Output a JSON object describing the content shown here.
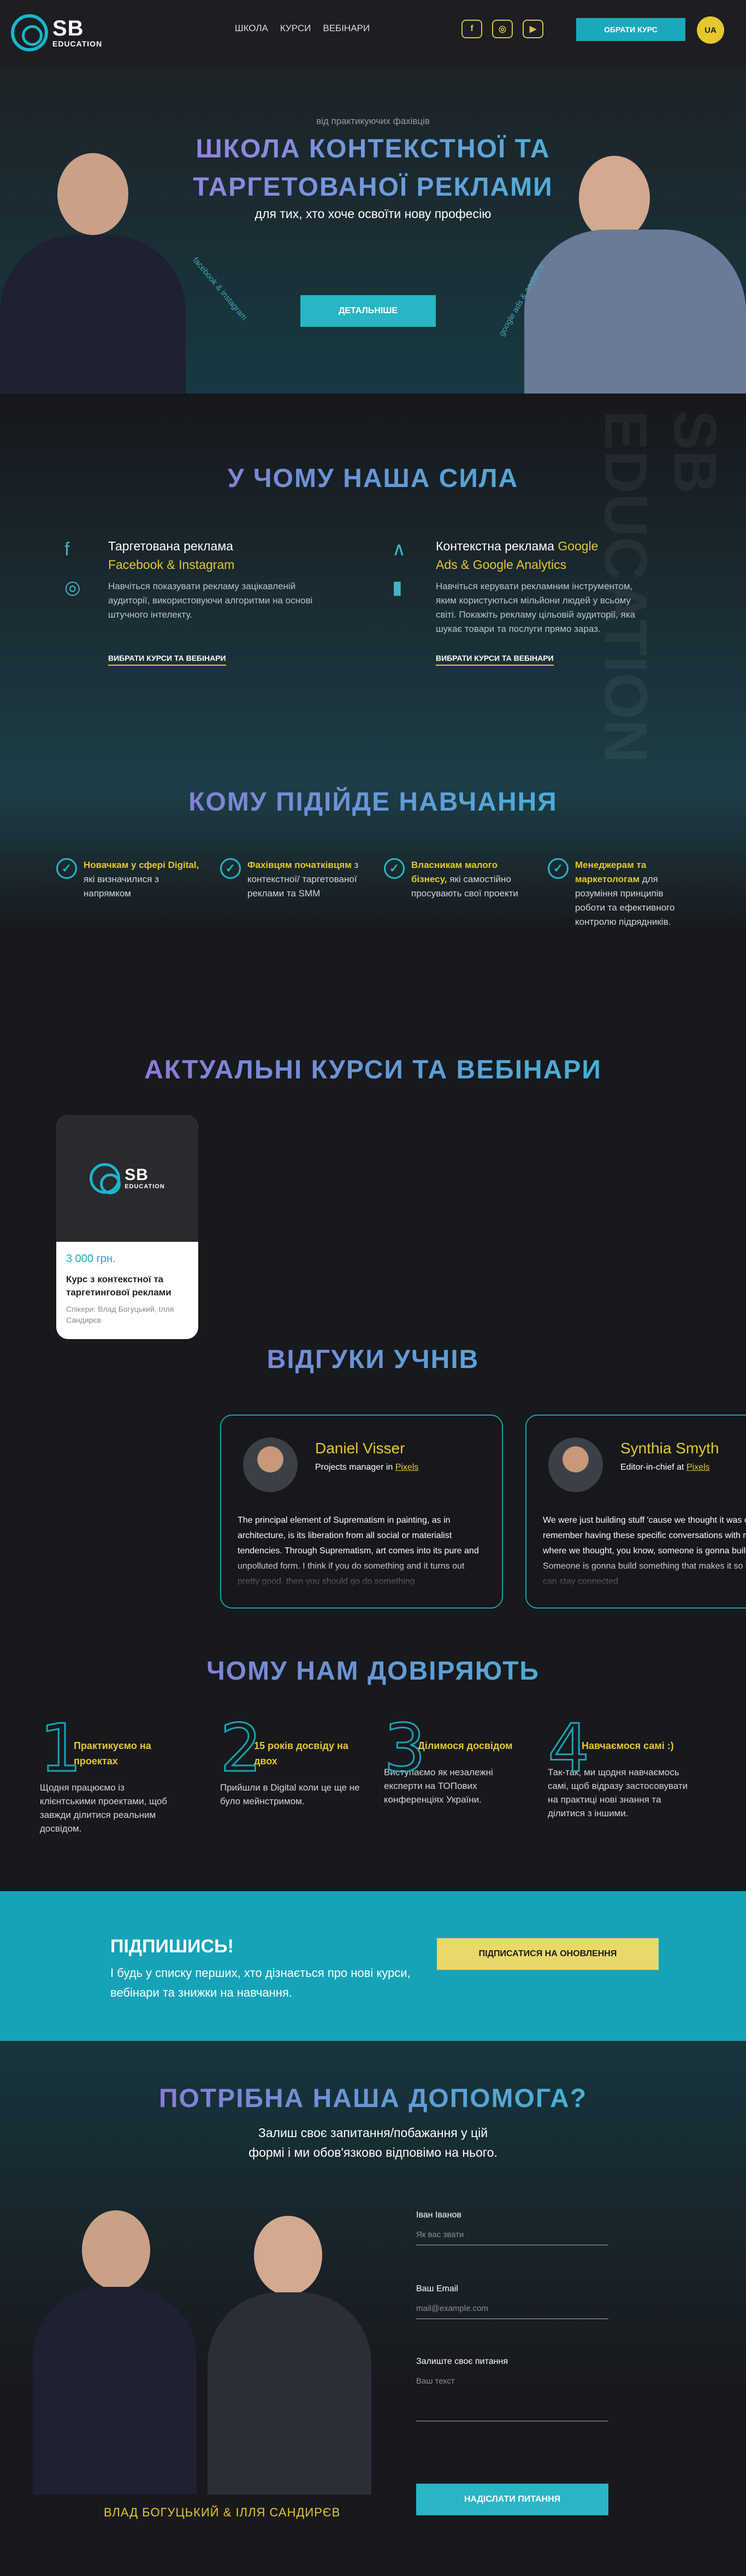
{
  "header": {
    "logo_top": "SB",
    "logo_bottom": "EDUCATION",
    "nav": [
      "ШКОЛА",
      "КУРСИ",
      "ВЕБІНАРИ"
    ],
    "cta": "ОБРАТИ КУРС",
    "lang": "UA",
    "social": [
      "f",
      "◎",
      "▶"
    ]
  },
  "hero": {
    "sub": "від практикуючих фахівців",
    "title1": "ШКОЛА КОНТЕКСТНОЇ ТА",
    "title2": "ТАРГЕТОВАНОЇ РЕКЛАМИ",
    "tagline": "для тих, хто хоче освоїти нову професію",
    "button": "ДЕТАЛЬНІШЕ",
    "ring_left": "facebook & instagram",
    "ring_right": "google ads & analytics"
  },
  "power": {
    "title": "У ЧОМУ НАША СИЛА",
    "watermark": "SB EDUCATION",
    "left": {
      "h1": "Таргетована реклама",
      "h2": "Facebook & Instagram",
      "desc": "Навчіться показувати рекламу зацікавленій аудиторії, використовуючи алгоритми на основі штучного інтелекту.",
      "link": "ВИБРАТИ КУРСИ ТА ВЕБІНАРИ"
    },
    "right": {
      "h1": "Контекстна реклама ",
      "h1b": "Google",
      "h2": "Ads & Google Analytics",
      "desc": "Навчіться керувати рекламним інструментом, яким користуються мільйони людей у всьому світі. Покажіть рекламу цільовій аудиторії, яка шукає товари та послуги прямо зараз.",
      "link": "ВИБРАТИ КУРСИ ТА ВЕБІНАРИ"
    }
  },
  "who": {
    "title": "КОМУ ПІДІЙДЕ НАВЧАННЯ",
    "items": [
      {
        "b": "Новачкам у сфері Digital,",
        "t": " які визначилися з напрямком"
      },
      {
        "b": "Фахівцям початківцям",
        "t": " з контекстної/ таргетованої реклами та SMM"
      },
      {
        "b": "Власникам малого бізнесу,",
        "t": " які самостійно просувають свої проекти"
      },
      {
        "b": "Менеджерам та маркетологам",
        "t": " для розуміння принципів роботи та ефективного контролю підрядників."
      }
    ]
  },
  "courses": {
    "title": "АКТУАЛЬНІ КУРСИ ТА ВЕБІНАРИ",
    "card": {
      "logo_top": "SB",
      "logo_bottom": "EDUCATION",
      "price": "3 000 грн.",
      "name": "Курс з контекстної та таргетингової реклами",
      "authors": "Спікери: Влад Богуцький, Ілля Сандирєв"
    }
  },
  "reviews": {
    "title": "ВІДГУКИ УЧНІВ",
    "items": [
      {
        "name": "Daniel Visser",
        "role": "Projects manager in ",
        "org": "Pixels",
        "text": "The principal element of Suprematism in painting, as in architecture, is its liberation from all social or materialist tendencies. Through Suprematism, art comes into its pure and unpolluted form. I think if you do something and it turns out pretty good, then you should go do something"
      },
      {
        "name": "Synthia Smyth",
        "role": "Editor-in-chief at ",
        "org": "Pixels",
        "text": "We were just building stuff 'cause we thought it was cool. I do remember having these specific conversations with my friends where we thought, you know, someone is gonna build this. Someone is gonna build something that makes it so that people can stay connected"
      }
    ]
  },
  "trust": {
    "title": "ЧОМУ НАМ ДОВІРЯЮТЬ",
    "items": [
      {
        "n": "1",
        "t": "Практикуємо на проектах",
        "d": "Щодня працюємо із клієнтськими проектами, щоб завжди ділитися реальним досвідом."
      },
      {
        "n": "2",
        "t": "15 років досвіду на двох",
        "d": "Прийшли в Digital коли це ще не було мейнстримом."
      },
      {
        "n": "3",
        "t": "Ділимося досвідом",
        "d": "Виступаємо як незалежні експерти на ТОПових конференціях України."
      },
      {
        "n": "4",
        "t": "Навчаємося самі :)",
        "d": "Так-так, ми щодня навчаємось самі, щоб відразу застосовувати на практиці нові знання та ділитися з іншими."
      }
    ]
  },
  "subscribe": {
    "title": "ПІДПИШИСЬ!",
    "desc": "І будь у списку перших, хто дізнається про нові курси, вебінари та знижки на навчання.",
    "button": "ПІДПИСАТИСЯ НА ОНОВЛЕННЯ"
  },
  "help": {
    "title": "ПОТРІБНА НАША ДОПОМОГА?",
    "desc1": "Залиш своє запитання/побажання у цій",
    "desc2": "формі і ми обов'язково відповімо на нього.",
    "name_label": "Іван Іванов",
    "name_ph": "Як вас звати",
    "email_label": "Ваш Email",
    "email_ph": "mail@example.com",
    "q_label": "Залиште своє питання",
    "q_ph": "Ваш текст",
    "button": "НАДІСЛАТИ ПИТАННЯ",
    "names": "ВЛАД БОГУЦЬКИЙ & ІЛЛЯ САНДИРЄВ"
  }
}
